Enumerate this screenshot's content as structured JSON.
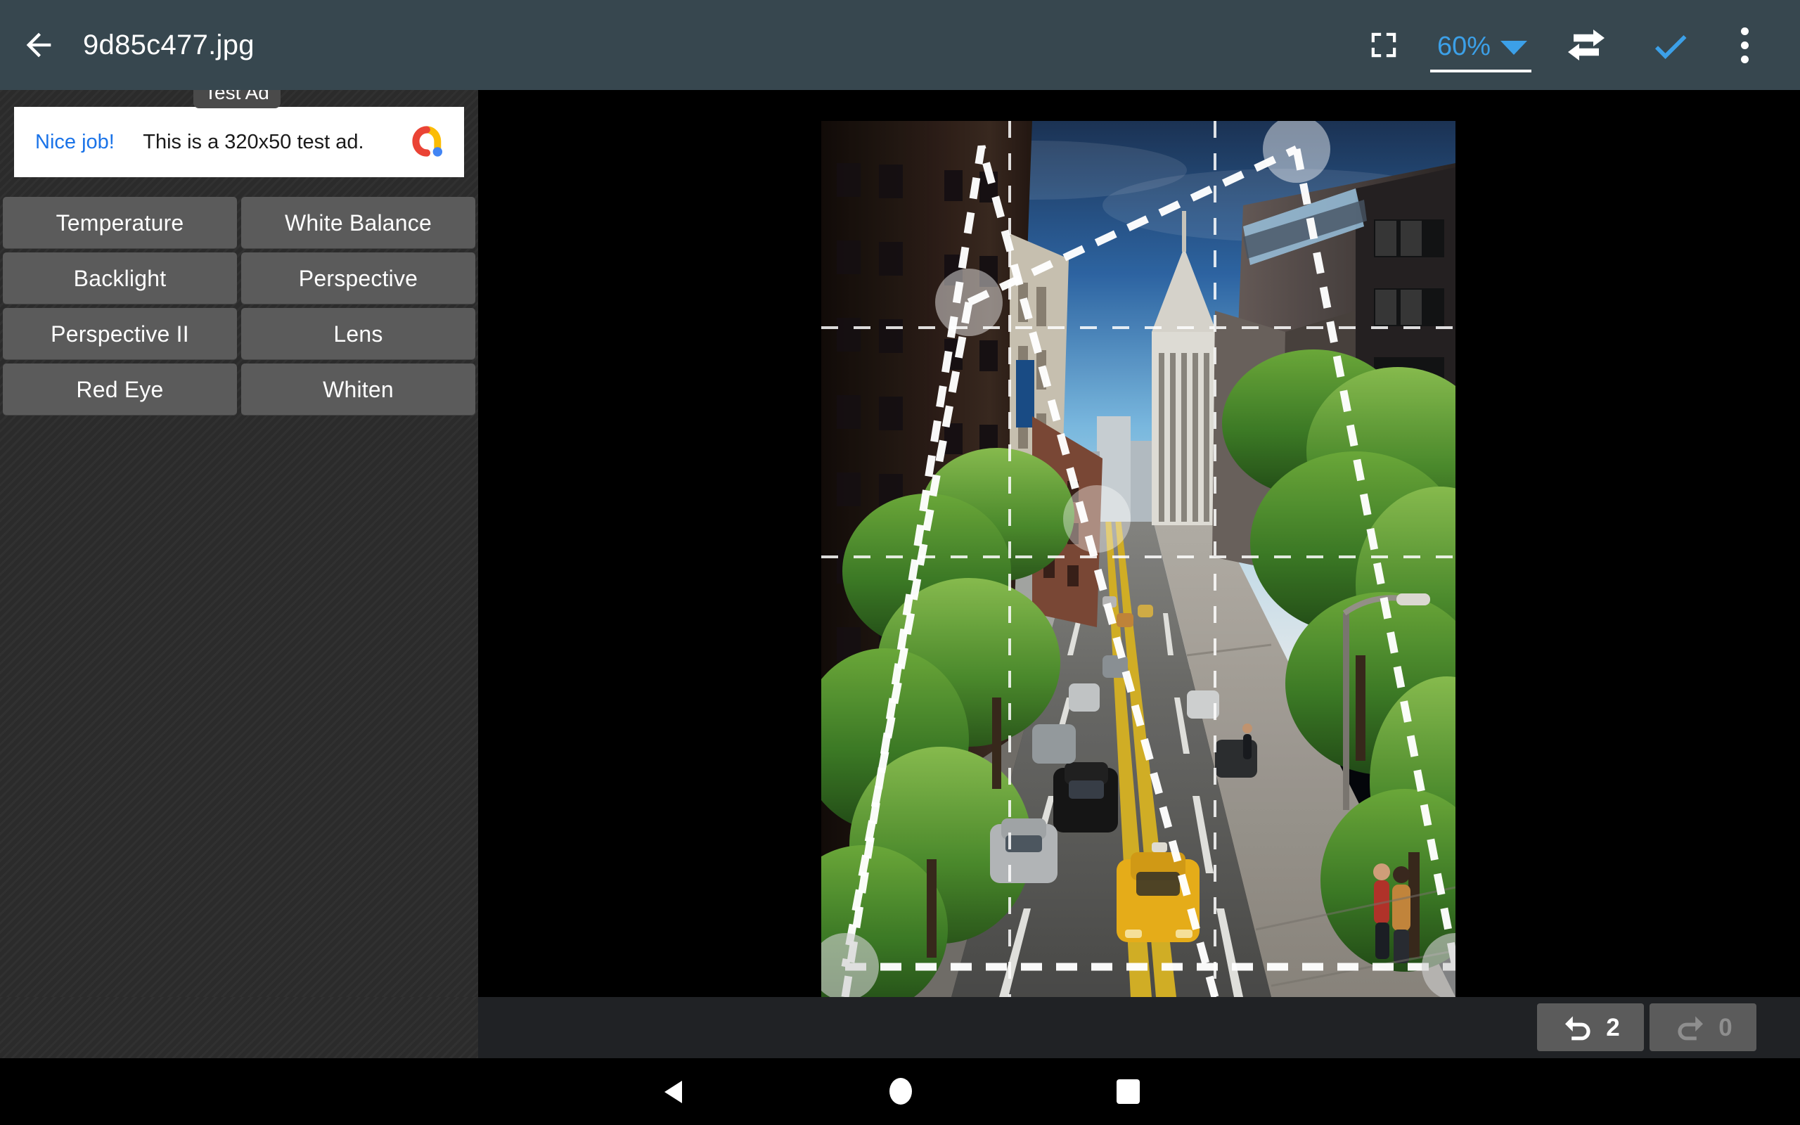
{
  "appbar": {
    "back_icon": "arrow-left-icon",
    "title": "9d85c477.jpg",
    "fit_icon": "fit-to-screen-icon",
    "zoom_value": "60%",
    "zoom_caret_icon": "chevron-down-icon",
    "compare_icon": "compare-swap-arrows-icon",
    "apply_icon": "checkmark-icon",
    "more_icon": "overflow-menu-icon",
    "bar_color": "#37474f",
    "accent_color": "#3ca0e8"
  },
  "ad": {
    "badge_label": "Test Ad",
    "cta_label": "Nice job!",
    "body_text": "This is a 320x50 test ad.",
    "logo_icon": "admob-logo-icon",
    "cta_color": "#1a73e8",
    "logo_colors": {
      "red": "#ea4335",
      "yellow": "#fbbc04",
      "blue": "#4285f4"
    }
  },
  "tools": {
    "buttons": [
      {
        "label": "Temperature"
      },
      {
        "label": "White Balance"
      },
      {
        "label": "Backlight"
      },
      {
        "label": "Perspective"
      },
      {
        "label": "Perspective II"
      },
      {
        "label": "Lens"
      },
      {
        "label": "Red Eye"
      },
      {
        "label": "Whiten"
      }
    ],
    "button_color": "#5b5b5b"
  },
  "canvas": {
    "photo_description": "City street view looking down a tree-lined avenue with tall buildings, a yellow taxi and cars on the road",
    "overlay_type": "perspective-correction-trapezoid",
    "grid_lines": "rule-of-thirds-dashed",
    "handle_count": 4,
    "background_color": "#000000"
  },
  "history": {
    "undo_icon": "undo-arrow-icon",
    "undo_count": "2",
    "redo_icon": "redo-arrow-icon",
    "redo_count": "0",
    "undo_enabled": "true",
    "redo_enabled": "false"
  },
  "navbar": {
    "back_icon": "nav-back-triangle-icon",
    "home_icon": "nav-home-circle-icon",
    "recents_icon": "nav-recents-square-icon"
  }
}
